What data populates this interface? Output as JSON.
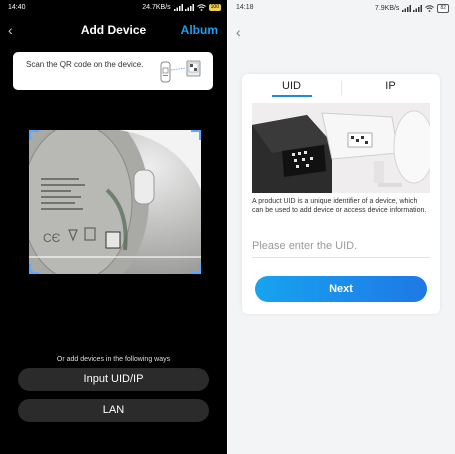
{
  "left_screen": {
    "status_bar": {
      "time": "14:40",
      "net_speed": "24.7KB/s",
      "battery": "100"
    },
    "header": {
      "title": "Add Device",
      "album_label": "Album"
    },
    "hint": {
      "text": "Scan the QR code on the device."
    },
    "alt_methods": {
      "caption": "Or add devices in the following ways",
      "input_uid_ip_label": "Input UID/IP",
      "lan_label": "LAN"
    },
    "scanner": {
      "accent_color": "#5aa9ff"
    }
  },
  "right_screen": {
    "status_bar": {
      "time": "14:18",
      "net_speed": "7.9KB/s",
      "battery": "82"
    },
    "tabs": [
      {
        "label": "UID",
        "active": true
      },
      {
        "label": "IP",
        "active": false
      }
    ],
    "description": "A product UID is a unique identifier of a device, which can be used to add device or access device information.",
    "uid_input": {
      "placeholder": "Please enter the UID.",
      "value": ""
    },
    "next_label": "Next",
    "accent_color": "#1e88e5"
  }
}
